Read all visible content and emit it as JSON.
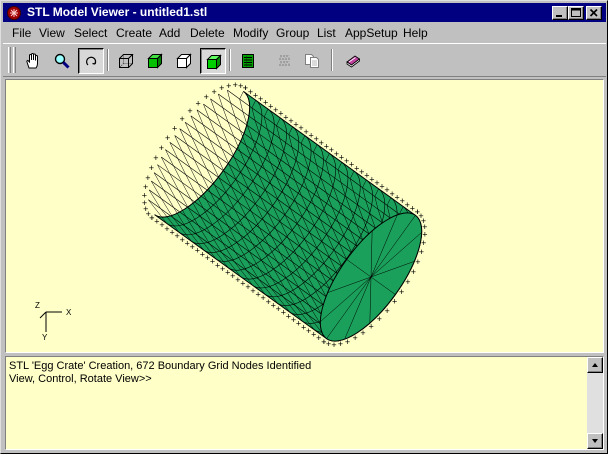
{
  "window": {
    "title": "STL Model Viewer - untitled1.stl",
    "icons": {
      "app": "stl-app-icon",
      "minimize": "minimize-icon",
      "maximize": "maximize-icon",
      "close": "close-icon"
    }
  },
  "menu": {
    "items": [
      "File",
      "View",
      "Select",
      "Create",
      "Add",
      "Delete",
      "Modify",
      "Group",
      "List",
      "AppSetup",
      "Help"
    ]
  },
  "toolbar": {
    "buttons": [
      {
        "icon": "pan-hand-icon",
        "pressed": false
      },
      {
        "icon": "zoom-magnifier-icon",
        "pressed": false
      },
      {
        "icon": "rotate-view-icon",
        "pressed": true
      },
      {
        "icon": "wireframe-cube-icon",
        "pressed": false
      },
      {
        "icon": "shaded-cube-green-icon",
        "pressed": false
      },
      {
        "icon": "hidden-line-cube-icon",
        "pressed": false
      },
      {
        "icon": "solid-cube-green-icon",
        "pressed": true
      },
      {
        "icon": "spreadsheet-icon",
        "pressed": false
      },
      {
        "icon": "grid-tool-icon",
        "pressed": false
      },
      {
        "icon": "copy-pages-icon",
        "pressed": false
      },
      {
        "icon": "book-help-icon",
        "pressed": false
      }
    ]
  },
  "viewport": {
    "background": "#ffffc8",
    "model": {
      "shape": "cylinder",
      "fill": "#1aa05a",
      "edge": "#000000",
      "node_marker": "+"
    },
    "axis_triad": {
      "labels": {
        "x": "X",
        "y": "Y",
        "z": "Z"
      }
    }
  },
  "console": {
    "lines": [
      "STL 'Egg Crate' Creation, 672 Boundary Grid Nodes Identified",
      "View, Control, Rotate View>>"
    ]
  },
  "colors": {
    "titlebar": "#000080",
    "face": "#c0c0c0",
    "model_green": "#1aa05a",
    "panel_bg": "#ffffc8"
  }
}
